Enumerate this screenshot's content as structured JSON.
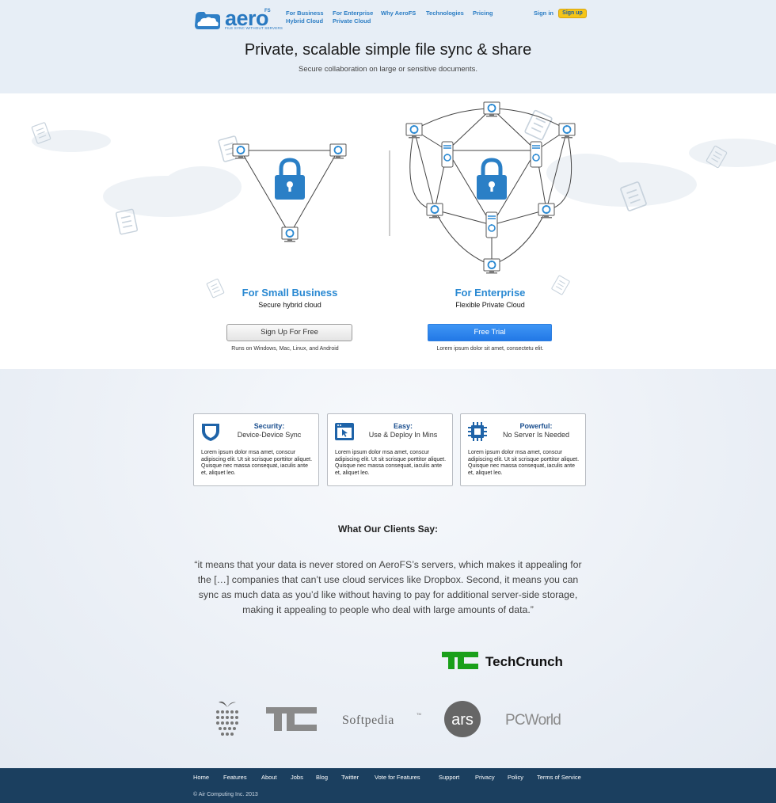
{
  "header": {
    "logo": {
      "word": "aero",
      "superscript": "FS",
      "tagline": "FILE SYNC WITHOUT SERVERS"
    },
    "nav": [
      {
        "label": "For Business",
        "sub": "Hybrid Cloud"
      },
      {
        "label": "For Enterprise",
        "sub": "Private Cloud"
      },
      {
        "label": "Why AeroFS"
      },
      {
        "label": "Technologies"
      },
      {
        "label": "Pricing"
      }
    ],
    "sign_in": "Sign in",
    "sign_up": "Sign up",
    "title": "Private, scalable simple file sync & share",
    "subtitle": "Secure collaboration on large or sensitive documents."
  },
  "plans": {
    "small": {
      "title": "For Small Business",
      "subtitle": "Secure hybrid cloud",
      "button": "Sign Up For Free",
      "note": "Runs on Windows, Mac, Linux, and Android"
    },
    "enterprise": {
      "title": "For Enterprise",
      "subtitle": "Flexible Private Cloud",
      "button": "Free Trial",
      "note": "Lorem ipsum dolor sit amet, consectetu elit."
    }
  },
  "features": [
    {
      "icon": "shield-icon",
      "title": "Security:",
      "subtitle": "Device-Device Sync",
      "body": "Lorem ipsum dolor msa amet, conscur adipiscing elit. Ut sit scrisque porttitor aliquet. Quisque nec massa consequat, iaculis ante et, aliquet leo."
    },
    {
      "icon": "cursor-window-icon",
      "title": "Easy:",
      "subtitle": "Use & Deploy In Mins",
      "body": "Lorem ipsum dolor msa amet, conscur adipiscing elit. Ut sit scrisque porttitor aliquet. Quisque nec massa consequat, iaculis ante et, aliquet leo."
    },
    {
      "icon": "chip-icon",
      "title": "Powerful:",
      "subtitle": "No Server Is Needed",
      "body": "Lorem ipsum dolor msa amet, conscur adipiscing elit. Ut sit scrisque porttitor aliquet. Quisque nec massa consequat, iaculis ante et, aliquet leo."
    }
  ],
  "testimonial": {
    "heading": "What Our Clients Say:",
    "quote": "“it means that your data is never stored on AeroFS’s servers, which makes it appealing for the […] companies that can’t use cloud services like Dropbox. Second, it means you can sync as much data as you’d like without having to pay for additional server-side storage, making it appealing to people who deal with large amounts of data.”",
    "source": "TechCrunch"
  },
  "press": [
    "Softpedia",
    "ars",
    "PCWorld"
  ],
  "footer": {
    "links": [
      "Home",
      "Features",
      "About",
      "Jobs",
      "Blog",
      "Twitter",
      "Vote for Features",
      "Support",
      "Privacy",
      "Policy",
      "Terms of Service"
    ],
    "copyright": "© Air Computing Inc. 2013"
  },
  "colors": {
    "brand_blue": "#2a89d2",
    "header_bg": "#e7eef6",
    "footer_bg": "#1b3f5f",
    "cta_blue": "#2f86ee",
    "signup_yellow": "#f5c518",
    "techcrunch_green": "#1aa01a"
  }
}
